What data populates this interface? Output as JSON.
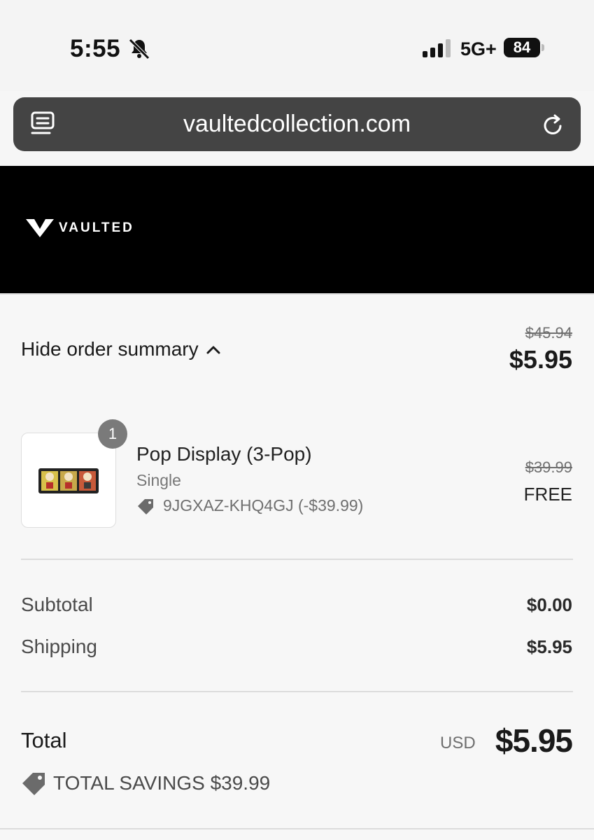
{
  "status_bar": {
    "time": "5:55",
    "network": "5G+",
    "battery": "84"
  },
  "browser": {
    "url": "vaultedcollection.com"
  },
  "header": {
    "brand": "VAULTED"
  },
  "summary": {
    "toggle_label": "Hide order summary",
    "original_total": "$45.94",
    "total": "$5.95"
  },
  "product": {
    "quantity": "1",
    "title": "Pop Display (3-Pop)",
    "variant": "Single",
    "discount": "9JGXAZ-KHQ4GJ (-$39.99)",
    "original_price": "$39.99",
    "price": "FREE"
  },
  "lines": {
    "subtotal_label": "Subtotal",
    "subtotal_value": "$0.00",
    "shipping_label": "Shipping",
    "shipping_value": "$5.95"
  },
  "total": {
    "label": "Total",
    "currency": "USD",
    "value": "$5.95",
    "savings": "TOTAL SAVINGS $39.99"
  }
}
